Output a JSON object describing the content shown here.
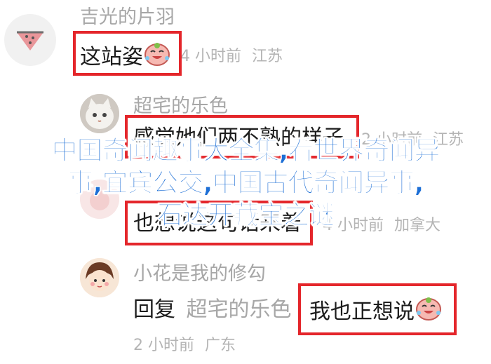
{
  "comments": [
    {
      "avatar_icon": "watermelon-icon",
      "username": "吉光的片羽",
      "text": "这站姿",
      "emoji": "laughing-crying-face-icon",
      "time": "4 小时前",
      "location": "江苏"
    },
    {
      "avatar_icon": "cat-photo-avatar",
      "username": "超宅的乐色",
      "text": "感觉她们两不熟的样子",
      "time": "2 小时前",
      "location": "江苏"
    },
    {
      "avatar_icon": "pink-avatar",
      "username": "",
      "text": "也想说这句话来着",
      "time": "4 小时前",
      "location": "加拿大"
    },
    {
      "avatar_icon": "girl-cartoon-avatar",
      "username": "小花是我的修勾",
      "reply_label": "回复",
      "reply_to": "超宅的乐色",
      "text": "我也正想说",
      "emoji": "laughing-crying-face-icon",
      "time": "2 小时前",
      "location": "广东"
    }
  ],
  "overlay_title": {
    "line1": "中国奇闻趣事大全集,看世界奇闻异",
    "line2": "事,宜宾公交,中国古代奇闻异事,",
    "line3": "石达开藏宝之谜"
  },
  "colors": {
    "highlight_box": "#e4262b",
    "overlay_text": "#1d6fd6",
    "username": "#a7a7a7",
    "meta": "#b4b4b4"
  }
}
